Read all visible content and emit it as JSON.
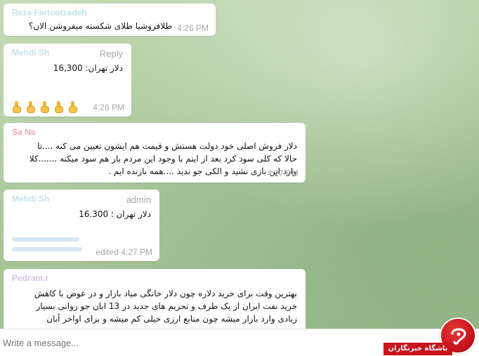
{
  "messages": [
    {
      "sender": "Reza Fartootzadeh",
      "tag": "",
      "lines": [
        "طلافروشیا طلای شکسته میفروشن الان؟"
      ],
      "time": "4:26 PM"
    },
    {
      "sender": "Mehdi Sh",
      "tag": "Reply",
      "lines": [
        "دلار تهران: 16,300"
      ],
      "time": "4:26 PM",
      "emoji_count": 5
    },
    {
      "sender": "Sa Na",
      "tag": "",
      "lines": [
        "دلار فروش اصلی خود دولت هستش و قیمت هم ایشون تعیین می کنه ....تا",
        "حالا که کلی سود کرد بعد از اینم با وجود این مردم باز هم سود میکنه .......کلا",
        "وارد این بازی نشید و الکی جو ندید ....همه بازنده ایم ."
      ],
      "time": "4:27 PM"
    },
    {
      "sender": "Mehdi Sh",
      "tag": "admin",
      "lines": [
        "دلار تهران ؛ 16.300"
      ],
      "time": "edited 4:27 PM"
    },
    {
      "sender": "Pedram.r",
      "tag": "",
      "lines": [
        "بهترین وقت برای خرید دلاره چون دلار خانگی میاد بازار و در عوض با کاهش",
        "خرید نفت ایران از یک طرف و تحریم های جدید در 13 ابان جو روانی بسیار",
        "زیادی وارد بازار میشه چون منابع ارزی خیلی کم میشه و برای اواخر آبان"
      ],
      "time": ""
    }
  ],
  "input": {
    "placeholder": "Write a message..."
  },
  "watermark": {
    "label": "باشگاه خبرنگاران",
    "color": "#c8141c"
  }
}
